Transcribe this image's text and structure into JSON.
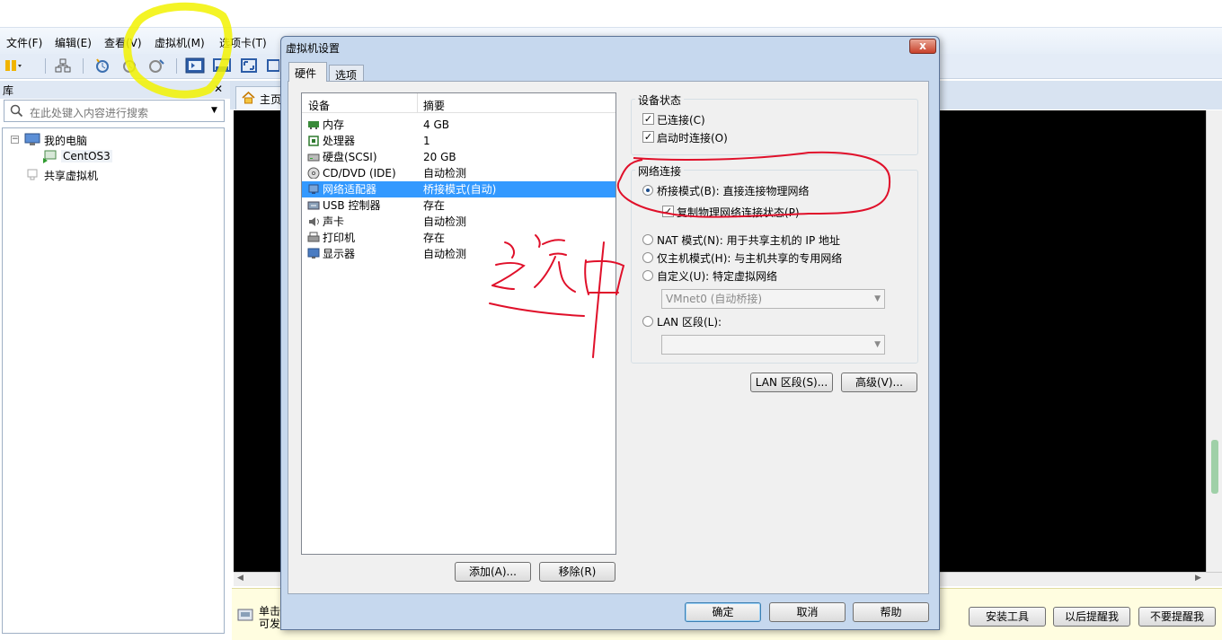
{
  "menu": [
    "文件(F)",
    "编辑(E)",
    "查看(V)",
    "虚拟机(M)",
    "选项卡(T)"
  ],
  "library": {
    "title": "库",
    "close": "✕",
    "search_placeholder": "在此处键入内容进行搜索",
    "tree": {
      "root": "我的电脑",
      "vm": "CentOS3",
      "shared": "共享虚拟机"
    }
  },
  "home_tab": "主页",
  "hint": {
    "line1": "单击",
    "line2": "可发",
    "install": "安装工具",
    "later": "以后提醒我",
    "never": "不要提醒我"
  },
  "dialog": {
    "title": "虚拟机设置",
    "close": "x",
    "tabs": [
      "硬件",
      "选项"
    ],
    "columns": {
      "device": "设备",
      "summary": "摘要"
    },
    "devices": [
      {
        "icon": "memory-icon",
        "label": "内存",
        "summary": "4 GB"
      },
      {
        "icon": "cpu-icon",
        "label": "处理器",
        "summary": "1"
      },
      {
        "icon": "disk-icon",
        "label": "硬盘(SCSI)",
        "summary": "20 GB"
      },
      {
        "icon": "cd-icon",
        "label": "CD/DVD (IDE)",
        "summary": "自动检测"
      },
      {
        "icon": "network-icon",
        "label": "网络适配器",
        "summary": "桥接模式(自动)"
      },
      {
        "icon": "usb-icon",
        "label": "USB 控制器",
        "summary": "存在"
      },
      {
        "icon": "sound-icon",
        "label": "声卡",
        "summary": "自动检测"
      },
      {
        "icon": "printer-icon",
        "label": "打印机",
        "summary": "存在"
      },
      {
        "icon": "display-icon",
        "label": "显示器",
        "summary": "自动检测"
      }
    ],
    "selected_device": 4,
    "add_button": "添加(A)...",
    "remove_button": "移除(R)",
    "device_status": {
      "title": "设备状态",
      "connected": "已连接(C)",
      "connect_on_start": "启动时连接(O)"
    },
    "network": {
      "title": "网络连接",
      "bridged": "桥接模式(B): 直接连接物理网络",
      "replicate": "复制物理网络连接状态(P)",
      "nat": "NAT 模式(N): 用于共享主机的 IP 地址",
      "host_only": "仅主机模式(H): 与主机共享的专用网络",
      "custom": "自定义(U): 特定虚拟网络",
      "custom_value": "VMnet0 (自动桥接)",
      "lan": "LAN 区段(L):",
      "lan_value": ""
    },
    "lan_segments_button": "LAN 区段(S)...",
    "advanced_button": "高级(V)...",
    "ok": "确定",
    "cancel": "取消",
    "help": "帮助"
  },
  "colors": {
    "selection": "#3399ff",
    "annotation_red": "#e0102a",
    "highlight_yellow": "#f2f200"
  }
}
